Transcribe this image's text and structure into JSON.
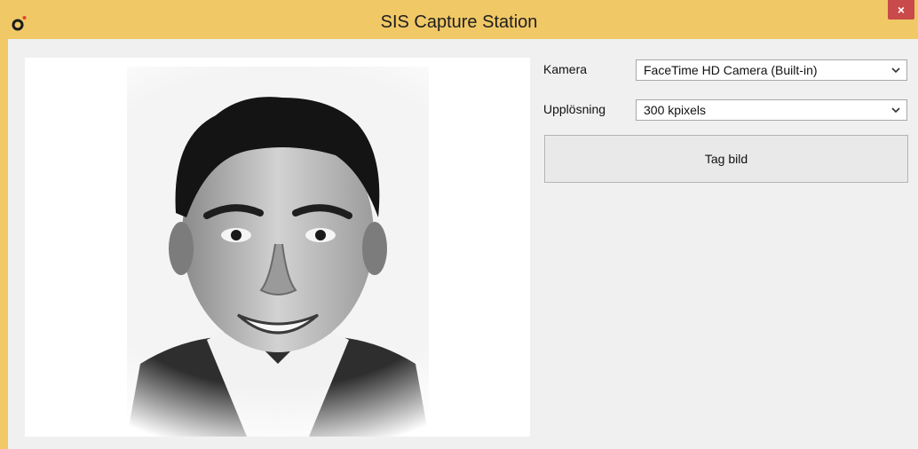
{
  "window": {
    "title": "SIS Capture Station",
    "icon": "app-logo-icon",
    "close_label": "×"
  },
  "form": {
    "camera_label": "Kamera",
    "camera_value": "FaceTime HD Camera (Built-in)",
    "resolution_label": "Upplösning",
    "resolution_value": "300 kpixels",
    "capture_button": "Tag bild"
  },
  "colors": {
    "titlebar": "#f0c866",
    "close": "#c84a4a",
    "client_bg": "#f0f0f0"
  }
}
